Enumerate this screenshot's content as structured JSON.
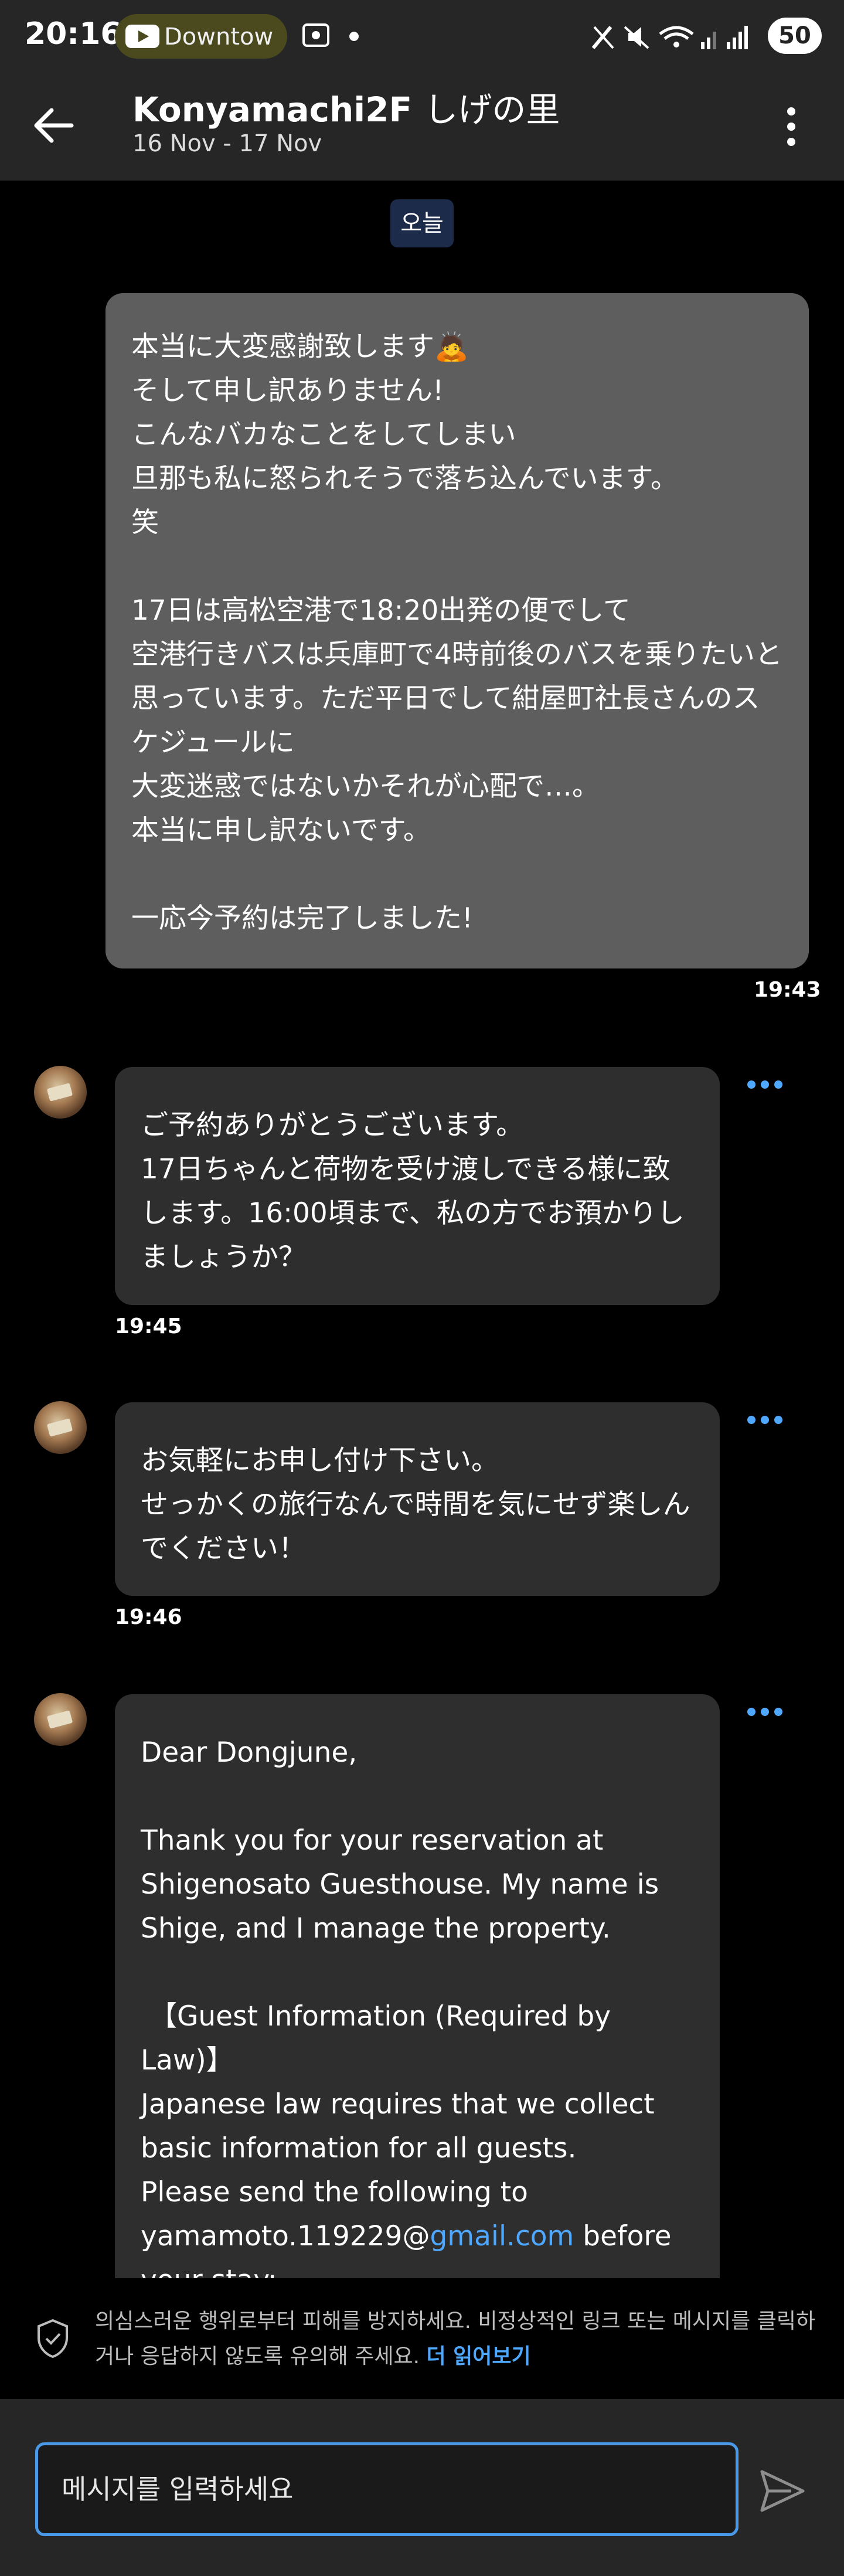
{
  "status_bar": {
    "time": "20:16",
    "media_text": "Downtow",
    "battery": "50"
  },
  "header": {
    "title_main": "Konyamachi2F",
    "title_jp": "しげの里",
    "dates": "16 Nov - 17 Nov"
  },
  "date_chip": "오늘",
  "messages": [
    {
      "text": "本当に大変感謝致します🙇\nそして申し訳ありません!\nこんなバカなことをしてしまい\n旦那も私に怒られそうで落ち込んでいます。\n笑\n\n17日は高松空港で18:20出発の便でして\n空港行きバスは兵庫町で4時前後のバスを乗りたいと思っています。ただ平日でして紺屋町社長さんのスケジュールに\n大変迷惑ではないかそれが心配で…。\n本当に申し訳ないです。\n\n一応今予約は完了しました!",
      "time": "19:43"
    },
    {
      "text": "ご予約ありがとうございます。\n17日ちゃんと荷物を受け渡しできる様に致します。16:00頃まで、私の方でお預かりしましょうか？",
      "time": "19:45"
    },
    {
      "text": "お気軽にお申し付け下さい。\nせっかくの旅行なんで時間を気にせず楽しんでください！",
      "time": "19:46"
    },
    {
      "text_before_link": "Dear Dongjune,\n\nThank you for your reservation at Shigenosato Guesthouse. My name is Shige, and I manage the property.\n\n 【Guest Information (Required by Law)】\nJapanese law requires that we collect basic information for all guests.\nPlease send the following to\nyamamoto.119229@",
      "link": "gmail.com",
      "text_after_link": " before\nyour stay:"
    }
  ],
  "warning": {
    "text": "의심스러운 행위로부터 피해를 방지하세요. 비정상적인 링크 또는 메시지를 클릭하거나 응답하지 않도록 유의해 주세요. ",
    "link": "더 읽어보기"
  },
  "composer": {
    "placeholder": "메시지를 입력하세요"
  },
  "colors": {
    "accent": "#4a98e8",
    "link": "#4fa8ff",
    "outgoing_bubble": "#5e5e5e",
    "incoming_bubble": "#2e2e2e",
    "bar_bg": "#262626"
  }
}
